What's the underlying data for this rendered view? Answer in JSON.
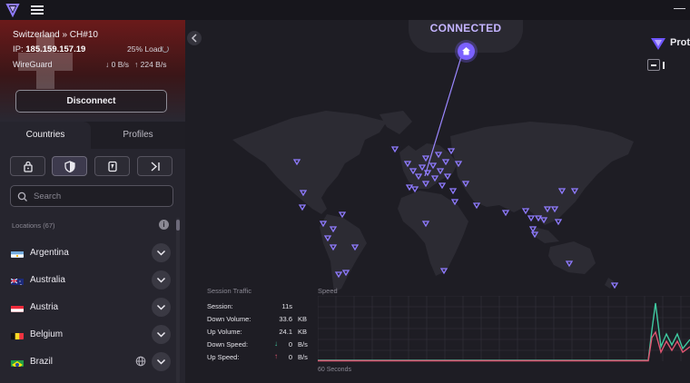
{
  "colors": {
    "accent": "#7b61ff",
    "connected": "#c4b4ff",
    "download_line": "#3fc9a0",
    "upload_line": "#e05571",
    "disconnect_bg": "#3a1618"
  },
  "header": {
    "logo_icon": "proton-vpn-icon",
    "menu_icon": "hamburger-icon",
    "window_controls": [
      "minimize-icon",
      "maximize-icon"
    ]
  },
  "connection": {
    "server": "Switzerland » CH#10",
    "ip_label": "IP:",
    "ip": "185.159.157.19",
    "load": "25% Load",
    "protocol": "WireGuard",
    "down_rate": "0 B/s",
    "up_rate": "224 B/s",
    "disconnect_label": "Disconnect"
  },
  "tabs": [
    {
      "label": "Countries",
      "active": true
    },
    {
      "label": "Profiles",
      "active": false
    }
  ],
  "filters": [
    {
      "icon": "lock-icon",
      "active": false
    },
    {
      "icon": "shield-icon",
      "active": true
    },
    {
      "icon": "tor-onion-icon",
      "active": false
    },
    {
      "icon": "p2p-arrow-icon",
      "active": false
    }
  ],
  "search": {
    "placeholder": "Search"
  },
  "locations": {
    "header": "Locations (67)",
    "items": [
      {
        "name": "Argentina",
        "flag": "argentina-flag"
      },
      {
        "name": "Australia",
        "flag": "australia-flag"
      },
      {
        "name": "Austria",
        "flag": "austria-flag"
      },
      {
        "name": "Belgium",
        "flag": "belgium-flag"
      },
      {
        "name": "Brazil",
        "flag": "brazil-flag",
        "extra_icon": "globe-icon"
      }
    ]
  },
  "status": {
    "text": "CONNECTED"
  },
  "brand": {
    "text": "Prot"
  },
  "session_traffic": {
    "header": "Session Traffic",
    "rows": [
      {
        "label": "Session:",
        "value": "11s",
        "unit": ""
      },
      {
        "label": "Down Volume:",
        "value": "33.6",
        "unit": "KB"
      },
      {
        "label": "Up Volume:",
        "value": "24.1",
        "unit": "KB"
      },
      {
        "label": "Down Speed:",
        "value": "0",
        "unit": "B/s",
        "arrow": "↓"
      },
      {
        "label": "Up Speed:",
        "value": "0",
        "unit": "B/s",
        "arrow": "↑"
      }
    ]
  },
  "speed_chart": {
    "header": "Speed",
    "time_label": "60 Seconds"
  }
}
